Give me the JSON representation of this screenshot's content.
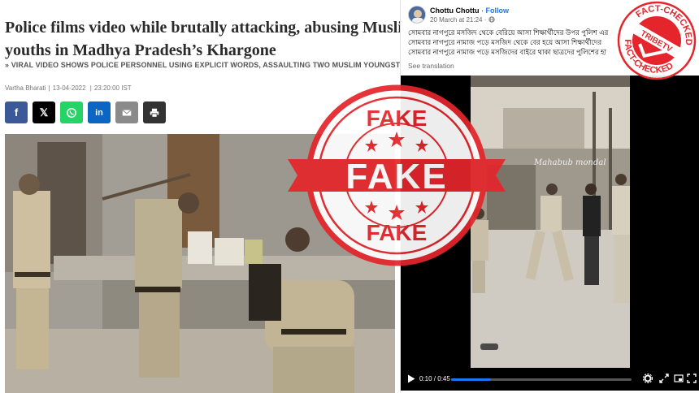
{
  "article": {
    "headline_line1": "Police films video while brutally attacking, abusing Muslim",
    "headline_line2": "youths in Madhya Pradesh’s Khargone",
    "subheadline": "» VIRAL VIDEO SHOWS POLICE PERSONNEL USING EXPLICIT WORDS, ASSAULTING TWO MUSLIM YOUNGSTERS",
    "author": "Vartha Bharati",
    "date": "13-04-2022",
    "time": "23:20:00 IST",
    "share_buttons": [
      {
        "icon": "facebook-icon",
        "label": "f",
        "color": "#3b5998"
      },
      {
        "icon": "x-icon",
        "label": "𝕏",
        "color": "#000000"
      },
      {
        "icon": "whatsapp-icon",
        "color": "#25d366"
      },
      {
        "icon": "linkedin-icon",
        "label": "in",
        "color": "#0a66c2"
      },
      {
        "icon": "email-icon",
        "color": "#8a8a8a"
      },
      {
        "icon": "print-icon",
        "color": "#333333"
      }
    ]
  },
  "post": {
    "author_name": "Chottu Chottu",
    "follow_label": "Follow",
    "separator": "·",
    "timestamp": "20 March at 21:24",
    "visibility_icon": "globe-icon",
    "text_lines": [
      "সোমবার নাগপুরে মসজিদ থেকে বেরিয়ে আসা শিক্ষার্থীদের উপর পুলিশ এর",
      "সোমবার নাগপুরে নামাজ পড়ে মসজিদ থেকে বের হয়ে আসা শিক্ষার্থীদের",
      "সোমবার নাগপুরে নামাজ পড়ে মসজিদের বাইরে থাকা ছাত্রদের পুলিশের হা"
    ],
    "see_translation": "See translation",
    "video": {
      "watermark": "Mahabub mondal",
      "time_display": "0:10 / 0:45",
      "progress": 0.22,
      "controls": [
        "play-icon",
        "settings-icon",
        "fullscreen-icon",
        "picture-in-picture-icon",
        "expand-icon"
      ]
    }
  },
  "stamps": {
    "fake": {
      "top": "FAKE",
      "center": "FAKE",
      "bottom": "FAKE",
      "color": "#e4262c"
    },
    "fact_checked": {
      "ring_top": "FACT-CHECKED",
      "ring_bottom": "FACT-CHECKED",
      "center": "TRIBETV",
      "color": "#e4262c"
    }
  }
}
